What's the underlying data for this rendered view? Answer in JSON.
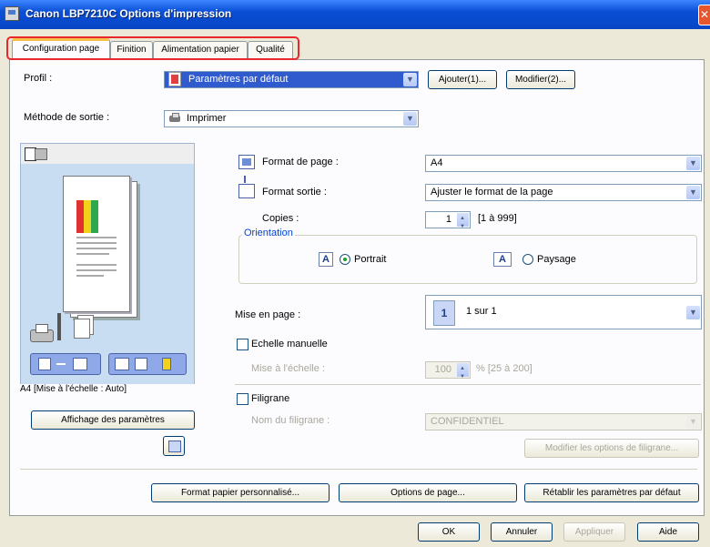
{
  "window": {
    "title": "Canon LBP7210C Options d'impression"
  },
  "tabs": [
    {
      "label": "Configuration page"
    },
    {
      "label": "Finition"
    },
    {
      "label": "Alimentation papier"
    },
    {
      "label": "Qualité"
    }
  ],
  "profile": {
    "label": "Profil :",
    "value": "Paramètres par défaut",
    "add_button": "Ajouter(1)...",
    "edit_button": "Modifier(2)..."
  },
  "output_method": {
    "label": "Méthode de sortie :",
    "value": "Imprimer"
  },
  "preview": {
    "caption": "A4 [Mise à l'échelle : Auto]"
  },
  "left_buttons": {
    "show_settings": "Affichage des paramètres"
  },
  "page_size": {
    "label": "Format de page :",
    "value": "A4"
  },
  "output_size": {
    "label": "Format sortie :",
    "value": "Ajuster le format de la page"
  },
  "copies": {
    "label": "Copies :",
    "value": "1",
    "range": "[1 à 999]"
  },
  "orientation": {
    "group_title": "Orientation",
    "portrait": "Portrait",
    "landscape": "Paysage",
    "selected": "portrait"
  },
  "layout": {
    "label": "Mise en page :",
    "value": "1 sur 1",
    "number": "1"
  },
  "manual_scaling": {
    "label": "Echelle manuelle",
    "scale_label": "Mise à l'échelle :",
    "value": "100",
    "range": "% [25 à 200]"
  },
  "watermark": {
    "label": "Filigrane",
    "name_label": "Nom du filigrane :",
    "value": "CONFIDENTIEL",
    "edit_button": "Modifier les options de filigrane..."
  },
  "bottom_buttons": {
    "custom_paper": "Format papier personnalisé...",
    "page_options": "Options de page...",
    "restore": "Rétablir les paramètres par défaut"
  },
  "dialog_buttons": {
    "ok": "OK",
    "cancel": "Annuler",
    "apply": "Appliquer",
    "help": "Aide"
  },
  "colors": {
    "titlebar": "#0a4fd6",
    "tab_highlight": "#e8282b",
    "selection": "#2f5bcf"
  }
}
